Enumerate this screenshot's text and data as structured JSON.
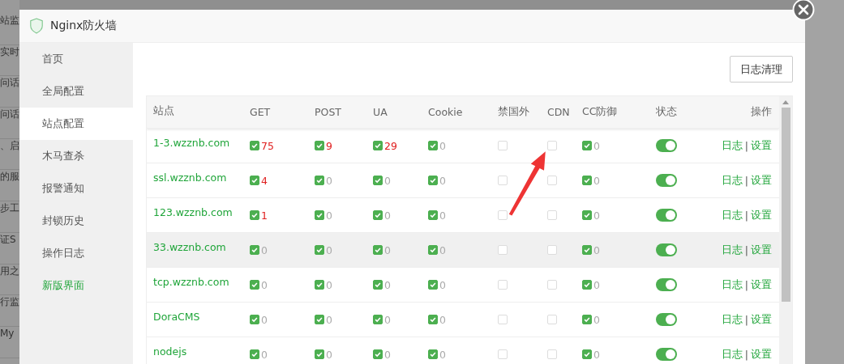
{
  "background": {
    "fragments": [
      "站监",
      "实时",
      "问话",
      "问话",
      "、启",
      "的服",
      "步工",
      "证S",
      "用之",
      "行监",
      "My"
    ]
  },
  "window": {
    "title": "Nginx防火墙"
  },
  "sidebar": {
    "items": [
      {
        "label": "首页",
        "selected": false,
        "kind": "normal"
      },
      {
        "label": "全局配置",
        "selected": false,
        "kind": "normal"
      },
      {
        "label": "站点配置",
        "selected": true,
        "kind": "normal"
      },
      {
        "label": "木马查杀",
        "selected": false,
        "kind": "normal"
      },
      {
        "label": "报警通知",
        "selected": false,
        "kind": "normal"
      },
      {
        "label": "封锁历史",
        "selected": false,
        "kind": "normal"
      },
      {
        "label": "操作日志",
        "selected": false,
        "kind": "normal"
      },
      {
        "label": "新版界面",
        "selected": false,
        "kind": "highlight"
      }
    ]
  },
  "toolbar": {
    "clear_log_button": "日志清理"
  },
  "table": {
    "columns": [
      "站点",
      "GET",
      "POST",
      "UA",
      "Cookie",
      "禁国外",
      "CDN",
      "CC防御",
      "状态",
      "操作"
    ],
    "rows": [
      {
        "site": "1-3.wzznb.com",
        "highlighted": false,
        "get": {
          "checked": true,
          "count": "75",
          "alert": true
        },
        "post": {
          "checked": true,
          "count": "9",
          "alert": true
        },
        "ua": {
          "checked": true,
          "count": "29",
          "alert": true
        },
        "cookie": {
          "checked": true,
          "count": "0",
          "alert": false
        },
        "ban_foreign": false,
        "cdn": false,
        "cc": {
          "checked": true,
          "count": "0",
          "alert": false
        },
        "status_on": true,
        "actions": [
          "日志",
          "|",
          "设置"
        ]
      },
      {
        "site": "ssl.wzznb.com",
        "highlighted": false,
        "get": {
          "checked": true,
          "count": "4",
          "alert": true
        },
        "post": {
          "checked": true,
          "count": "0",
          "alert": false
        },
        "ua": {
          "checked": true,
          "count": "0",
          "alert": false
        },
        "cookie": {
          "checked": true,
          "count": "0",
          "alert": false
        },
        "ban_foreign": false,
        "cdn": false,
        "cc": {
          "checked": true,
          "count": "0",
          "alert": false
        },
        "status_on": true,
        "actions": [
          "日志",
          "|",
          "设置"
        ]
      },
      {
        "site": "123.wzznb.com",
        "highlighted": false,
        "get": {
          "checked": true,
          "count": "1",
          "alert": true
        },
        "post": {
          "checked": true,
          "count": "0",
          "alert": false
        },
        "ua": {
          "checked": true,
          "count": "0",
          "alert": false
        },
        "cookie": {
          "checked": true,
          "count": "0",
          "alert": false
        },
        "ban_foreign": false,
        "cdn": false,
        "cc": {
          "checked": true,
          "count": "0",
          "alert": false
        },
        "status_on": true,
        "actions": [
          "日志",
          "|",
          "设置"
        ]
      },
      {
        "site": "33.wzznb.com",
        "highlighted": true,
        "get": {
          "checked": true,
          "count": "0",
          "alert": false
        },
        "post": {
          "checked": true,
          "count": "0",
          "alert": false
        },
        "ua": {
          "checked": true,
          "count": "0",
          "alert": false
        },
        "cookie": {
          "checked": true,
          "count": "0",
          "alert": false
        },
        "ban_foreign": false,
        "cdn": false,
        "cc": {
          "checked": true,
          "count": "0",
          "alert": false
        },
        "status_on": true,
        "actions": [
          "日志",
          "|",
          "设置"
        ]
      },
      {
        "site": "tcp.wzznb.com",
        "highlighted": false,
        "get": {
          "checked": true,
          "count": "0",
          "alert": false
        },
        "post": {
          "checked": true,
          "count": "0",
          "alert": false
        },
        "ua": {
          "checked": true,
          "count": "0",
          "alert": false
        },
        "cookie": {
          "checked": true,
          "count": "0",
          "alert": false
        },
        "ban_foreign": false,
        "cdn": false,
        "cc": {
          "checked": true,
          "count": "0",
          "alert": false
        },
        "status_on": true,
        "actions": [
          "日志",
          "|",
          "设置"
        ]
      },
      {
        "site": "DoraCMS",
        "highlighted": false,
        "get": {
          "checked": true,
          "count": "0",
          "alert": false
        },
        "post": {
          "checked": true,
          "count": "0",
          "alert": false
        },
        "ua": {
          "checked": true,
          "count": "0",
          "alert": false
        },
        "cookie": {
          "checked": true,
          "count": "0",
          "alert": false
        },
        "ban_foreign": false,
        "cdn": false,
        "cc": {
          "checked": true,
          "count": "0",
          "alert": false
        },
        "status_on": true,
        "actions": [
          "日志",
          "|",
          "设置"
        ]
      },
      {
        "site": "nodejs",
        "highlighted": false,
        "get": {
          "checked": true,
          "count": "0",
          "alert": false
        },
        "post": {
          "checked": true,
          "count": "0",
          "alert": false
        },
        "ua": {
          "checked": true,
          "count": "0",
          "alert": false
        },
        "cookie": {
          "checked": true,
          "count": "0",
          "alert": false
        },
        "ban_foreign": false,
        "cdn": false,
        "cc": {
          "checked": true,
          "count": "0",
          "alert": false
        },
        "status_on": true,
        "actions": [
          "日志",
          "|",
          "设置"
        ]
      }
    ]
  }
}
